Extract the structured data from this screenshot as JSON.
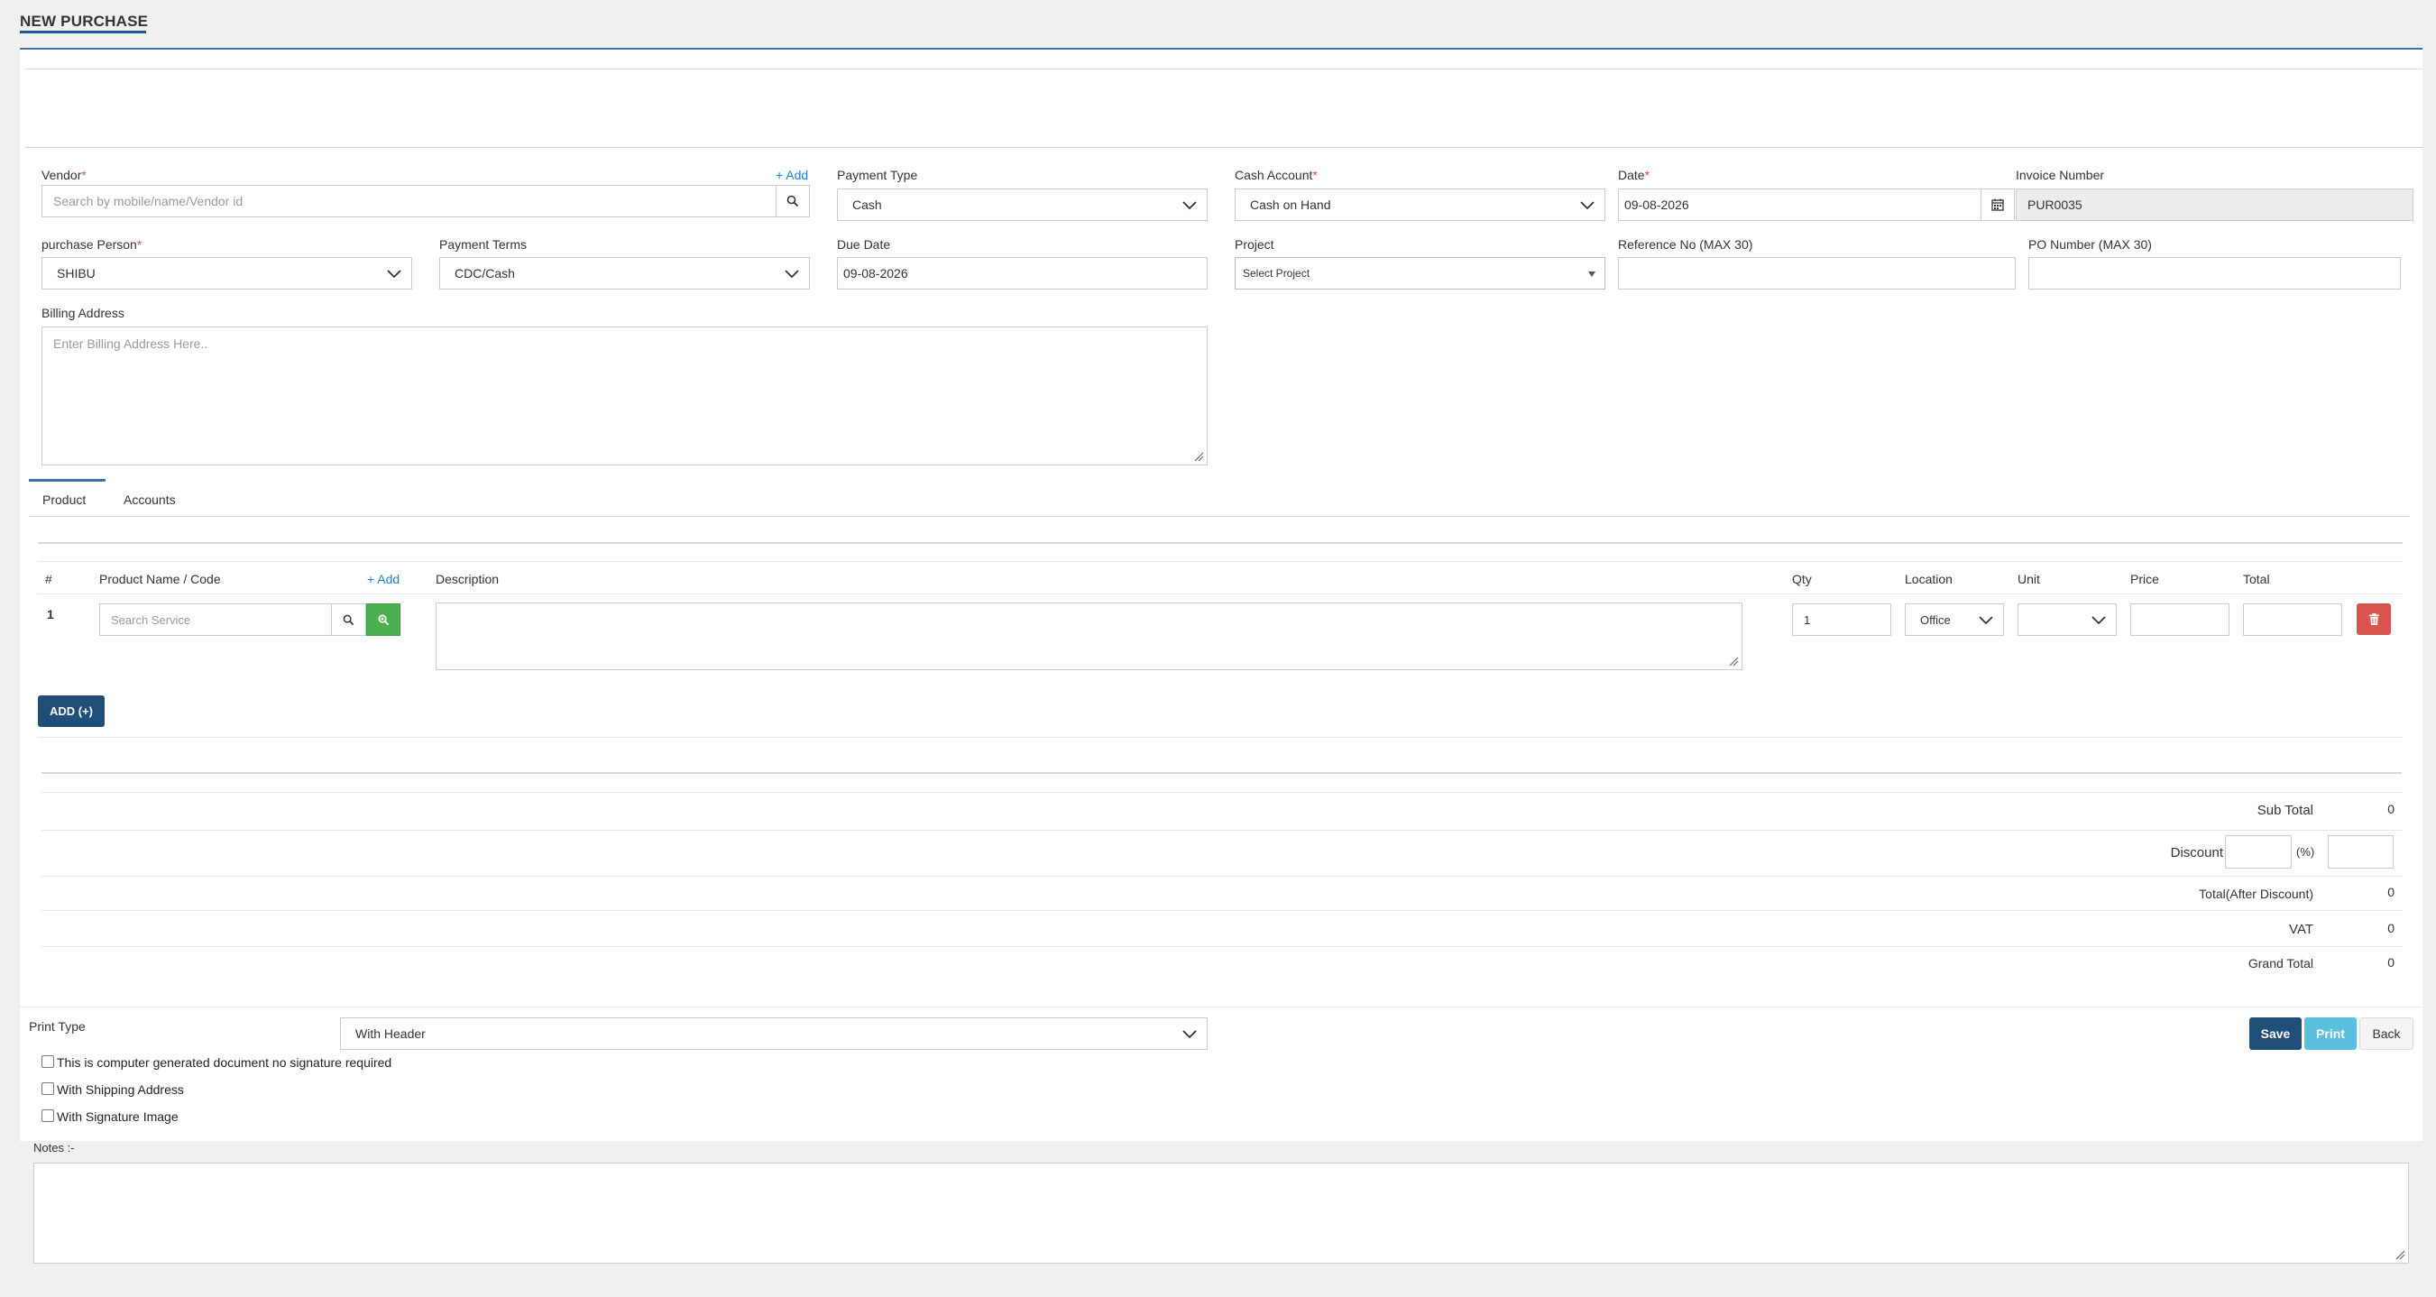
{
  "page": {
    "title": "NEW PURCHASE"
  },
  "form": {
    "vendor": {
      "label": "Vendor",
      "required_mark": "*",
      "add_link": "+ Add",
      "placeholder": "Search by mobile/name/Vendor id",
      "search_icon": "search-icon"
    },
    "payment_type": {
      "label": "Payment Type",
      "value": "Cash"
    },
    "cash_account": {
      "label": "Cash Account",
      "required_mark": "*",
      "value": "Cash on Hand"
    },
    "date": {
      "label": "Date",
      "required_mark": "*",
      "value": "09-08-2026",
      "icon": "calendar-icon"
    },
    "invoice_number": {
      "label": "Invoice Number",
      "value": "PUR0035"
    },
    "purchase_person": {
      "label": "purchase Person",
      "required_mark": "*",
      "value": "SHIBU"
    },
    "payment_terms": {
      "label": "Payment Terms",
      "value": "CDC/Cash"
    },
    "due_date": {
      "label": "Due Date",
      "value": "09-08-2026"
    },
    "project": {
      "label": "Project",
      "value": "Select Project"
    },
    "reference_no": {
      "label": "Reference No (MAX 30)",
      "value": ""
    },
    "po_number": {
      "label": "PO Number (MAX 30)",
      "value": ""
    },
    "billing_address": {
      "label": "Billing Address",
      "placeholder": "Enter Billing Address Here.."
    }
  },
  "tabs": [
    {
      "label": "Product",
      "active": true
    },
    {
      "label": "Accounts",
      "active": false
    }
  ],
  "items_table": {
    "headers": {
      "index": "#",
      "product": "Product Name / Code",
      "add_link": "+ Add",
      "description": "Description",
      "qty": "Qty",
      "location": "Location",
      "unit": "Unit",
      "price": "Price",
      "total": "Total"
    },
    "rows": [
      {
        "index": "1",
        "product_placeholder": "Search Service",
        "description": "",
        "qty": "1",
        "location": "Office",
        "unit": "",
        "price": "",
        "total": ""
      }
    ],
    "add_button": "ADD (+)"
  },
  "summary": {
    "sub_total": {
      "label": "Sub Total",
      "value": "0"
    },
    "discount": {
      "label": "Discount",
      "percent_suffix": "(%)",
      "percent": "",
      "amount": ""
    },
    "total_after_discount": {
      "label": "Total(After Discount)",
      "value": "0"
    },
    "vat": {
      "label": "VAT",
      "value": "0"
    },
    "grand_total": {
      "label": "Grand Total",
      "value": "0"
    }
  },
  "print": {
    "label": "Print Type",
    "value": "With Header",
    "options": [
      {
        "label": "This is computer generated document no signature required",
        "checked": false
      },
      {
        "label": "With Shipping Address",
        "checked": false
      },
      {
        "label": "With Signature Image",
        "checked": false
      }
    ]
  },
  "actions": {
    "save": "Save",
    "print": "Print",
    "back": "Back"
  },
  "notes": {
    "label": "Notes :-",
    "value": ""
  },
  "colors": {
    "primary": "#1f4e79",
    "accent_blue": "#3a73ad",
    "print_button": "#5bc0de",
    "danger": "#d9534f",
    "success": "#4caf50",
    "link": "#1e7fd6"
  }
}
